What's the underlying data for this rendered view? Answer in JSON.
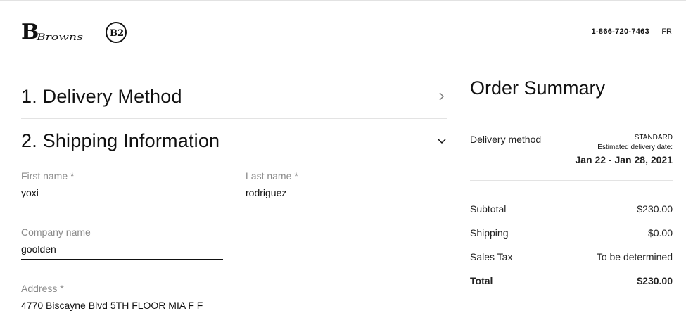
{
  "header": {
    "logo_text": "Browns",
    "logo_badge": "B2",
    "phone": "1-866-720-7463",
    "language": "FR"
  },
  "sections": {
    "delivery_method": {
      "title": "1. Delivery Method",
      "icon": "chevron-right-icon"
    },
    "shipping_info": {
      "title": "2. Shipping Information",
      "icon": "chevron-down-icon"
    }
  },
  "form": {
    "first_name": {
      "label": "First name *",
      "value": "yoxi"
    },
    "last_name": {
      "label": "Last name *",
      "value": "rodriguez"
    },
    "company_name": {
      "label": "Company name",
      "value": "goolden"
    },
    "address": {
      "label": "Address *",
      "value": "4770 Biscayne Blvd 5TH FLOOR MIA F F"
    }
  },
  "summary": {
    "title": "Order Summary",
    "delivery_method_label": "Delivery method",
    "delivery_method_value": "STANDARD",
    "estimated_label": "Estimated delivery date:",
    "estimated_dates": "Jan 22 - Jan 28, 2021",
    "subtotal_label": "Subtotal",
    "subtotal_value": "$230.00",
    "shipping_label": "Shipping",
    "shipping_value": "$0.00",
    "tax_label": "Sales Tax",
    "tax_value": "To be determined",
    "total_label": "Total",
    "total_value": "$230.00"
  }
}
